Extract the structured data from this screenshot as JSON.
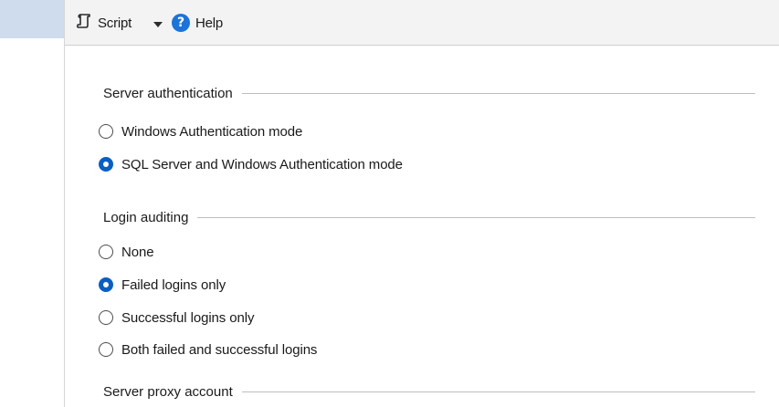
{
  "toolbar": {
    "script_label": "Script",
    "help_label": "Help",
    "help_glyph": "?"
  },
  "server_authentication": {
    "title": "Server authentication",
    "options": [
      {
        "label": "Windows Authentication mode",
        "selected": false
      },
      {
        "label": "SQL Server and Windows Authentication mode",
        "selected": true
      }
    ]
  },
  "login_auditing": {
    "title": "Login auditing",
    "options": [
      {
        "label": "None",
        "selected": false
      },
      {
        "label": "Failed logins only",
        "selected": true
      },
      {
        "label": "Successful logins only",
        "selected": false
      },
      {
        "label": "Both failed and successful logins",
        "selected": false
      }
    ]
  },
  "server_proxy_account": {
    "title": "Server proxy account"
  },
  "colors": {
    "accent": "#0a5fc4",
    "help_icon": "#1c73d9",
    "toolbar_bg": "#f3f3f3",
    "left_selection": "#cfdcee"
  },
  "icons": {
    "script": "script-icon",
    "dropdown": "chevron-down-icon",
    "help": "help-icon"
  }
}
